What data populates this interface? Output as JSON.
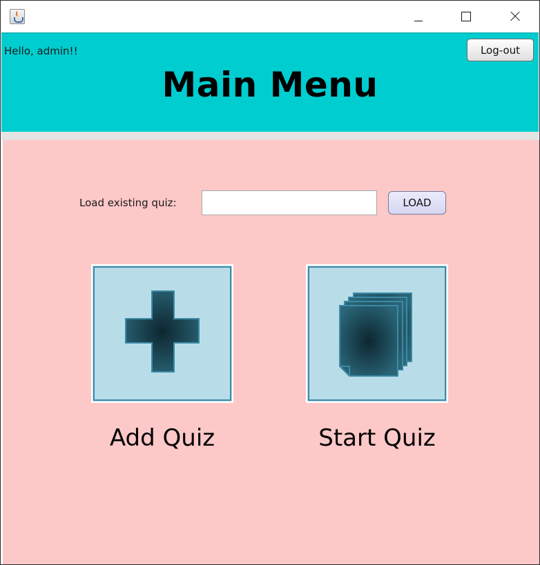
{
  "window": {
    "app_icon": "java-cup-icon",
    "controls": [
      "minimize-icon",
      "maximize-icon",
      "close-icon"
    ]
  },
  "header": {
    "greeting": "Hello, admin!!",
    "logout_label": "Log-out",
    "title": "Main Menu",
    "background": "#00cdd0"
  },
  "main": {
    "background": "#fdc8c8",
    "load": {
      "label": "Load existing quiz:",
      "value": "",
      "placeholder": "",
      "button_label": "LOAD"
    },
    "actions": [
      {
        "label": "Add Quiz",
        "icon": "plus-icon"
      },
      {
        "label": "Start Quiz",
        "icon": "stacked-pages-icon"
      }
    ],
    "tile_color": "#b9dde8",
    "icon_color": "#1e4d5c"
  }
}
